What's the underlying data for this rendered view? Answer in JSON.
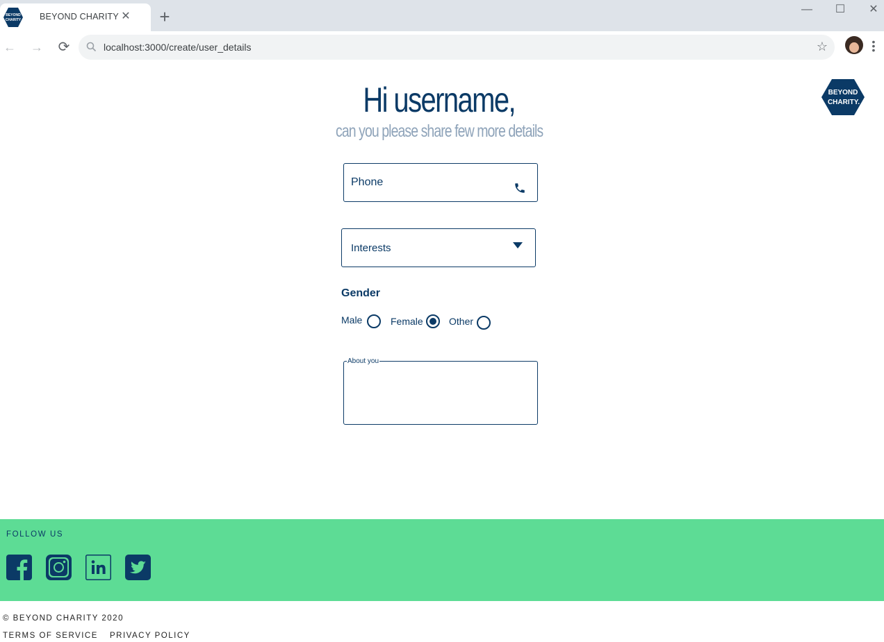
{
  "browser": {
    "tab_title": "BEYOND CHARITY",
    "url": "localhost:3000/create/user_details",
    "tab_close": "✕",
    "new_tab": "+",
    "window_controls": {
      "minimize": "—",
      "maximize": "☐",
      "close": "✕"
    },
    "nav": {
      "back": "←",
      "forward": "→",
      "reload": "⟳"
    },
    "bookmark_icon": "☆",
    "menu_icon": "⋮"
  },
  "logo": {
    "line1": "BEYOND",
    "line2": "CHARITY."
  },
  "favicon": {
    "line1": "BEYOND",
    "line2": "CHARITY"
  },
  "header": {
    "greeting": "Hi username,",
    "subtitle": "can you please share few more details"
  },
  "form": {
    "phone_placeholder": "Phone",
    "interests_label": "Interests",
    "gender_label": "Gender",
    "gender_options": [
      {
        "label": "Male",
        "selected": false
      },
      {
        "label": "Female",
        "selected": true
      },
      {
        "label": "Other",
        "selected": false
      }
    ],
    "about_label": "About you",
    "about_value": ""
  },
  "footer": {
    "follow_label": "FOLLOW US",
    "social": [
      "facebook-icon",
      "instagram-icon",
      "linkedin-icon",
      "twitter-icon"
    ],
    "copyright": "© BEYOND CHARITY 2020",
    "links": [
      "TERMS OF SERVICE",
      "PRIVACY POLICY"
    ]
  },
  "colors": {
    "brand_navy": "#0b3a66",
    "footer_green": "#5ddc95",
    "subtitle_gray": "#8ea3b9"
  }
}
